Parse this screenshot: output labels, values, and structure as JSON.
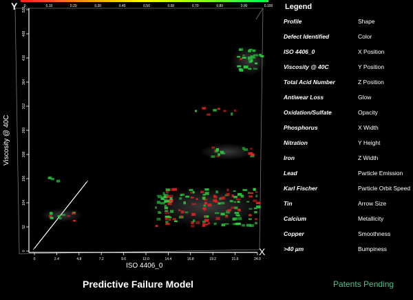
{
  "colorbar": {
    "ticks": [
      "0",
      "0.10",
      "0.20",
      "0.30",
      "0.40",
      "0.50",
      "0.60",
      "0.70",
      "0.80",
      "0.90",
      "0.100"
    ],
    "colors": [
      "#ff2020",
      "#ffff00",
      "#00ff40"
    ]
  },
  "axes": {
    "y_label": "Viscosity @ 40C",
    "x_label": "ISO 4406_0",
    "x_letter": "X",
    "y_letter": "Y",
    "y_ticks": [
      "0",
      "52",
      "104",
      "156",
      "208",
      "260",
      "312",
      "364",
      "416",
      "468",
      "520"
    ],
    "x_ticks": [
      "0",
      "2.4",
      "4.8",
      "7.2",
      "9.6",
      "12.0",
      "14.4",
      "16.8",
      "19.2",
      "21.6",
      "24.0"
    ]
  },
  "legend": {
    "title": "Legend",
    "rows": [
      {
        "key": "Profile",
        "value": "Shape"
      },
      {
        "key": "Defect Identified",
        "value": "Color"
      },
      {
        "key": "ISO 4406_0",
        "value": "X Position"
      },
      {
        "key": "Viscosity @ 40C",
        "value": "Y Position"
      },
      {
        "key": "Total Acid Number",
        "value": "Z Position"
      },
      {
        "key": "Antiwear Loss",
        "value": "Glow"
      },
      {
        "key": "Oxidation/Sulfate",
        "value": "Opacity"
      },
      {
        "key": "Phosphorus",
        "value": "X Width"
      },
      {
        "key": "Nitration",
        "value": "Y Height"
      },
      {
        "key": "Iron",
        "value": "Z Width"
      },
      {
        "key": "Lead",
        "value": "Particle Emission"
      },
      {
        "key": "Karl Fischer",
        "value": "Particle Orbit Speed"
      },
      {
        "key": "Tin",
        "value": "Arrow Size"
      },
      {
        "key": "Calcium",
        "value": "Metallicity"
      },
      {
        "key": "Copper",
        "value": "Smoothness"
      },
      {
        "key": ">40 µm",
        "value": "Bumpiness"
      }
    ]
  },
  "footer": {
    "title": "Predictive Failure Model",
    "note": "Patents Pending"
  },
  "colors": {
    "red": "#e02424",
    "green": "#2ecc40",
    "note": "#4fc08d"
  }
}
